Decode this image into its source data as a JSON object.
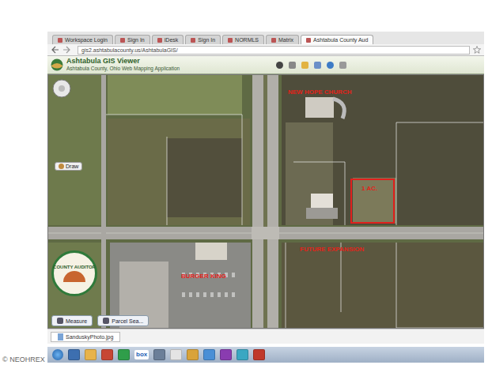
{
  "browser": {
    "tabs": [
      {
        "label": "Workspace Login",
        "selected": false
      },
      {
        "label": "Sign In",
        "selected": false
      },
      {
        "label": "iDesk",
        "selected": false
      },
      {
        "label": "Sign In",
        "selected": false
      },
      {
        "label": "NORMLS",
        "selected": false
      },
      {
        "label": "Matrix",
        "selected": false
      },
      {
        "label": "Ashtabula County Aud",
        "selected": true
      }
    ],
    "address": "gis2.ashtabulacounty.us/AshtabulaGIS/"
  },
  "app": {
    "title": "Ashtabula GIS Viewer",
    "subtitle": "Ashtabula County, Ohio Web Mapping Application"
  },
  "map": {
    "labels": [
      {
        "text": "NEW HOPE CHURCH"
      },
      {
        "text": "1 AC."
      },
      {
        "text": "FUTURE EXPANSION"
      },
      {
        "text": "BURGER KING"
      }
    ],
    "seal": {
      "text": "COUNTY AUDITOR"
    },
    "draw_tool": {
      "label": "Draw"
    },
    "buttons": [
      {
        "label": "Measure"
      },
      {
        "label": "Parcel Sea..."
      }
    ]
  },
  "download": {
    "file": "SanduskyPhoto.jpg"
  },
  "taskbar": {
    "box_label": "box"
  },
  "watermark": "© NEOHREX"
}
